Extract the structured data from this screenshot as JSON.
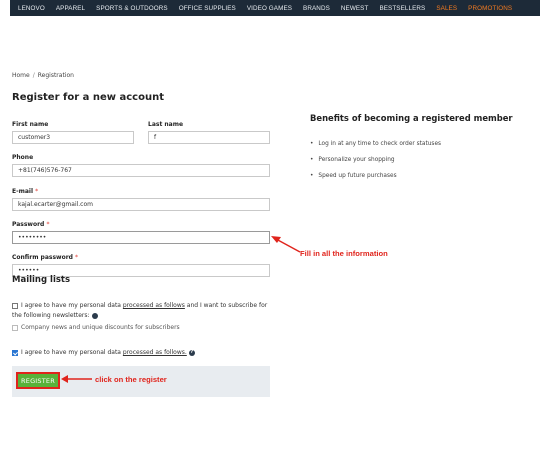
{
  "nav": {
    "items": [
      "LENOVO",
      "APPAREL",
      "SPORTS & OUTDOORS",
      "OFFICE SUPPLIES",
      "VIDEO GAMES",
      "BRANDS",
      "NEWEST",
      "BESTSELLERS"
    ],
    "highlight_items": [
      "SALES",
      "PROMOTIONS"
    ],
    "highlight_color": "#f47b20",
    "bar_color": "#1d2a38"
  },
  "breadcrumb": {
    "home": "Home",
    "separator": "/",
    "current": "Registration"
  },
  "page_title": "Register for a new account",
  "form": {
    "first_name": {
      "label": "First name",
      "value": "customer3"
    },
    "last_name": {
      "label": "Last name",
      "value": "f"
    },
    "phone": {
      "label": "Phone",
      "value": "+81(746)576-767"
    },
    "email": {
      "label": "E-mail",
      "required_mark": "*",
      "value": "kajal.ecarter@gmail.com"
    },
    "password": {
      "label": "Password",
      "required_mark": "*",
      "value": "12345678"
    },
    "confirm_password": {
      "label": "Confirm password",
      "required_mark": "*",
      "value": "123456"
    }
  },
  "mailing": {
    "title": "Mailing lists",
    "newsletter_consent": {
      "checked": false,
      "text_before": "I agree to have my personal data ",
      "link_text": "processed as follows",
      "text_after": " and I want to subscribe for the following newsletters:",
      "help_icon": "question-circle-icon"
    },
    "company_news": {
      "checked": false,
      "text": "Company news and unique discounts for subscribers"
    },
    "data_consent": {
      "checked": true,
      "text_before": "I agree to have my personal data ",
      "link_text": "processed as follows.",
      "help_icon": "question-circle-icon"
    }
  },
  "register_button": {
    "label": "REGISTER",
    "color": "#58b23a"
  },
  "benefits": {
    "title": "Benefits of becoming a registered member",
    "items": [
      "Log in at any time to check order statuses",
      "Personalize your shopping",
      "Speed up future purchases"
    ]
  },
  "annotations": {
    "fill_info": "Fill in all the information",
    "click_register": "click on the register",
    "color": "#e0241c"
  }
}
